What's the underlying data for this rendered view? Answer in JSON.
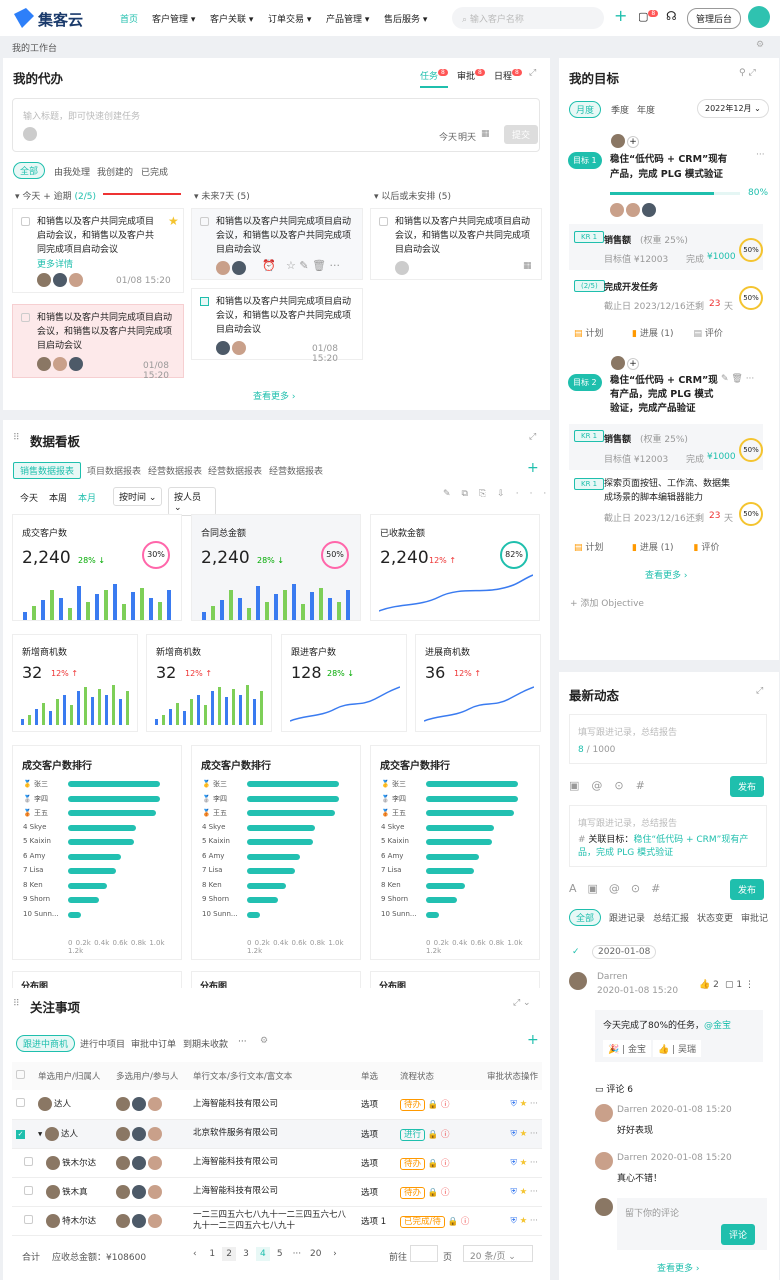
{
  "brand": {
    "name": "集客云"
  },
  "nav": {
    "items": [
      "首页",
      "客户管理",
      "客户关联",
      "订单交易",
      "产品管理",
      "售后服务"
    ],
    "search_placeholder": "输入客户名称",
    "admin": "管理后台",
    "badge": "8"
  },
  "breadcrumb": "我的工作台",
  "todo": {
    "title": "我的代办",
    "tabs": [
      {
        "label": "任务",
        "badge": "8"
      },
      {
        "label": "审批",
        "badge": "8"
      },
      {
        "label": "日程",
        "badge": "8"
      }
    ],
    "input_placeholder": "输入标题，即可快速创建任务",
    "today": "今天",
    "tomorrow": "明天",
    "submit": "提交",
    "filters": [
      "全部",
      "由我处理",
      "我创建的",
      "已完成"
    ],
    "columns": [
      {
        "title": "今天 + 逾期",
        "count": "(2/5)"
      },
      {
        "title": "未来7天",
        "count": "(5)"
      },
      {
        "title": "以后或未安排",
        "count": "(5)"
      }
    ],
    "task_text": "和销售以及客户共同完成项目启动会议，和销售以及客户共同完成项目启动会议",
    "more_detail": "更多详情",
    "time": "01/08 15:20",
    "see_more": "查看更多"
  },
  "dashboard": {
    "title": "数据看板",
    "tabs": [
      "销售数据报表",
      "项目数据报表",
      "经营数据报表",
      "经营数据报表",
      "经营数据报表"
    ],
    "periods": [
      "今天",
      "本周",
      "本月"
    ],
    "by_time": "按时间",
    "by_person": "按人员",
    "kpis": [
      {
        "label": "成交客户数",
        "value": "2,240",
        "pct": "28%",
        "dir": "down",
        "ring": "30%"
      },
      {
        "label": "合同总金额",
        "value": "2,240",
        "pct": "28%",
        "dir": "down",
        "ring": "50%"
      },
      {
        "label": "已收款金额",
        "value": "2,240",
        "pct": "12%",
        "dir": "up",
        "ring": "82%"
      }
    ],
    "small_kpis": [
      {
        "label": "新增商机数",
        "value": "32",
        "pct": "12%",
        "dir": "up"
      },
      {
        "label": "新增商机数",
        "value": "32",
        "pct": "12%",
        "dir": "up"
      },
      {
        "label": "跟进客户数",
        "value": "128",
        "pct": "28%",
        "dir": "down"
      },
      {
        "label": "进展商机数",
        "value": "36",
        "pct": "12%",
        "dir": "up"
      }
    ],
    "rank_title": "成交客户数排行",
    "rank_names": [
      "张三",
      "李四",
      "王五",
      "Skye",
      "Kaixin",
      "Amy",
      "Lisa",
      "Ken",
      "Shorn",
      "Sunn..."
    ],
    "rank_values": [
      1.05,
      1.05,
      1.0,
      0.78,
      0.75,
      0.6,
      0.55,
      0.45,
      0.35,
      0.15
    ],
    "rank_axis": [
      "0",
      "0.2k",
      "0.4k",
      "0.6k",
      "0.8k",
      "1.0k",
      "1.2k"
    ],
    "dist": "分布图"
  },
  "focus": {
    "title": "关注事项",
    "tabs": [
      "跟进中商机",
      "进行中项目",
      "审批中订单",
      "到期未收款",
      "···"
    ],
    "headers": [
      "单选用户/归属人",
      "多选用户/参与人",
      "单行文本/多行文本/富文本",
      "单选",
      "流程状态",
      "审批状态",
      "操作"
    ],
    "rows": [
      {
        "name": "达人",
        "company": "上海智能科技有限公司",
        "opt": "选项",
        "status": "待办"
      },
      {
        "name": "达人",
        "company": "北京软件服务有限公司",
        "opt": "选项",
        "status": "进行"
      },
      {
        "name": "铁木尔达",
        "company": "上海智能科技有限公司",
        "opt": "选项",
        "status": "待办"
      },
      {
        "name": "铁木真",
        "company": "上海智能科技有限公司",
        "opt": "选项",
        "status": "待办"
      },
      {
        "name": "特木尔达",
        "company": "一二三四五六七八九十一二三四五六七八九十一二三四五六七八九十",
        "opt": "选项 1",
        "status": "已完成/待"
      }
    ],
    "total": "合计",
    "total_amount": "应收总金额：¥108600",
    "pages": [
      "1",
      "2",
      "3",
      "4",
      "5",
      "···",
      "20"
    ],
    "goto": "前往",
    "page_unit": "页",
    "per_page": "20 条/页"
  },
  "goals": {
    "title": "我的目标",
    "tabs": [
      "月度",
      "季度",
      "年度"
    ],
    "month": "2022年12月",
    "g1": {
      "tag": "目标 1",
      "title": "稳住“低代码 + CRM”现有产品，完成 PLG 模式验证",
      "pct": "80%"
    },
    "kr1": {
      "tag": "KR 1",
      "name": "销售额",
      "weight": "(权重 25%)",
      "target": "目标值 ¥12003",
      "done": "完成",
      "done_val": "¥1000",
      "pct": "50%"
    },
    "kr2": {
      "tag": "KR 2",
      "name": "完成开发任务",
      "deadline": "截止日 2023/12/16",
      "left": "还剩",
      "days": "23",
      "unit": "天",
      "pct": "50%"
    },
    "actions": [
      "计划",
      "进展 (1)",
      "评价"
    ],
    "g2": {
      "tag": "目标 2",
      "title": "稳住“低代码 + CRM”现有产品，完成 PLG 模式验证，完成产品验证"
    },
    "kr3": {
      "tag": "KR 1",
      "name": "探索页面按钮、工作流、数据集成场景的脚本编辑器能力"
    },
    "see_more": "查看更多",
    "add": "添加 Objective"
  },
  "activity": {
    "title": "最新动态",
    "placeholder": "填写跟进记录，总结报告",
    "count": "8",
    "max": "/ 1000",
    "publish": "发布",
    "link_label": "关联目标：",
    "link_text": "稳住“低代码 + CRM”现有产品，完成 PLG 模式验证",
    "tabs": [
      "全部",
      "跟进记录",
      "总结汇报",
      "状态变更",
      "审批记"
    ],
    "date": "2020-01-08",
    "author": "Darren",
    "time": "2020-01-08 15:20",
    "likes": "2",
    "comments": "1",
    "content": "今天完成了80%的任务，",
    "mention": "@金宝",
    "react1": "金宝",
    "react2": "吴瑞",
    "comment_title": "评论 6",
    "c1": "好好表现",
    "c2": "真心不错！",
    "comment_placeholder": "留下你的评论",
    "comment_btn": "评论",
    "see_more": "查看更多"
  }
}
